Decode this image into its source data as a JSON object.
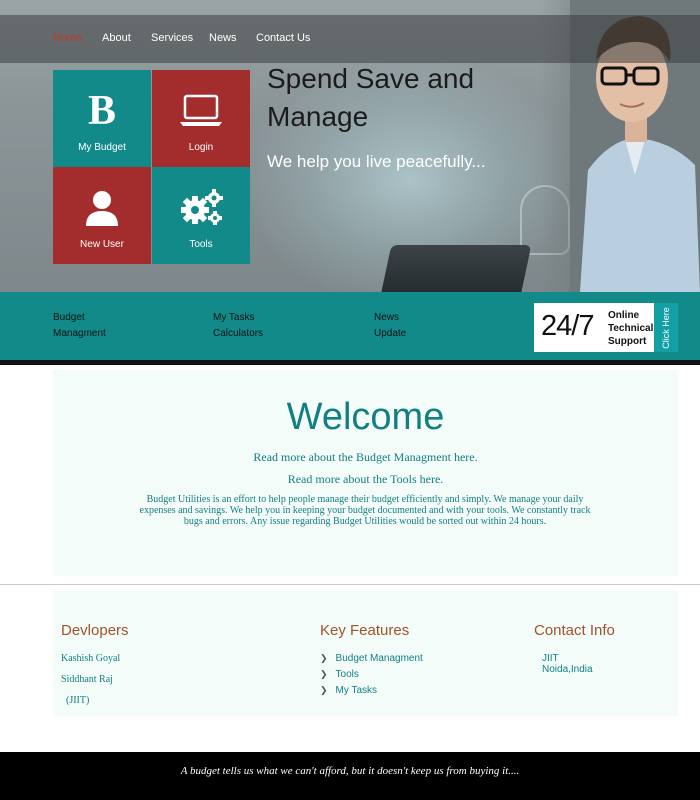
{
  "nav": {
    "items": [
      "Home",
      "About",
      "Services",
      "News",
      "Contact Us"
    ],
    "active": "Home"
  },
  "tiles": [
    {
      "label": "My Budget",
      "icon": "b-letter-icon",
      "glyph": "B"
    },
    {
      "label": "Login",
      "icon": "laptop-icon"
    },
    {
      "label": "New User",
      "icon": "user-icon"
    },
    {
      "label": "Tools",
      "icon": "gears-icon"
    }
  ],
  "hero": {
    "title": "Spend Save and Manage",
    "subtitle": "We help you live peacefully..."
  },
  "bar": {
    "links": [
      [
        "Budget",
        "Managment"
      ],
      [
        "My Tasks",
        "Calculators"
      ],
      [
        "News",
        "Update"
      ]
    ],
    "support": {
      "big": "24/7",
      "line1": "Online",
      "line2": "Technical",
      "line3": "Support",
      "cta": "Click Here"
    }
  },
  "welcome": {
    "title": "Welcome",
    "link1": "Read more about the Budget Managment here.",
    "link2": "Read more about the Tools here.",
    "description": "Budget Utilities is an effort to help people manage their budget efficiently and simply. We manage your daily expenses and savings. We help you in keeping your budget documented and with your tools. We constantly track bugs and errors. Any issue regarding Budget Utilities would be sorted out within 24 hours."
  },
  "footer": {
    "developers_title": "Devlopers",
    "developers": [
      "Kashish Goyal",
      "Siddhant Raj",
      "(JIIT)"
    ],
    "features_title": "Key Features",
    "features": [
      "Budget Managment",
      "Tools",
      "My Tasks"
    ],
    "contact_title": "Contact Info",
    "contact_lines": [
      "JIIT",
      "Noida,India"
    ]
  },
  "quote": "A budget tells us what we can't afford, but it doesn't keep us from buying it....",
  "colors": {
    "teal": "#138a8a",
    "red": "#a32d2d",
    "active_nav": "#c0392b",
    "heading_brown": "#a0522d"
  }
}
